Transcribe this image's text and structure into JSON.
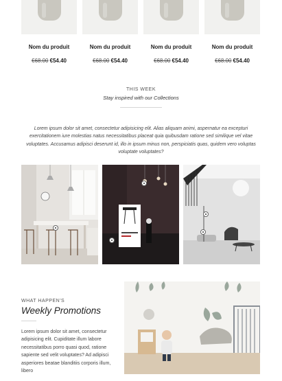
{
  "products": [
    {
      "name": "Nom du produit",
      "old_price": "€68.00",
      "new_price": "€54.40"
    },
    {
      "name": "Nom du produit",
      "old_price": "€68.00",
      "new_price": "€54.40"
    },
    {
      "name": "Nom du produit",
      "old_price": "€68.00",
      "new_price": "€54.40"
    },
    {
      "name": "Nom du produit",
      "old_price": "€68.00",
      "new_price": "€54.40"
    }
  ],
  "this_week": {
    "eyebrow": "THIS WEEK",
    "subtitle": "Stay inspired with our Collections",
    "text": "Lorem ipsum dolor sit amet, consectetur adipisicing elit. Alias aliquam animi, aspernatur ea excepturi exercitationem iure molestias natus necessitatibus placeat quia quibusdam ratione sed similique vel vitae voluptates. Accusamus adipisci deserunt id, illo in ipsum minus non, perspiciatis quas, quidem vero voluptas voluptate voluptates?"
  },
  "gallery": [
    {
      "name": "dining-room-photo"
    },
    {
      "name": "dark-studio-photo"
    },
    {
      "name": "living-room-photo"
    }
  ],
  "promotions": {
    "eyebrow": "WHAT HAPPEN'S",
    "title": "Weekly Promotions",
    "text": "Lorem ipsum dolor sit amet, consectetur adipisicing elit. Cupiditate illum labore necessitatibus porro quasi quod, ratione sapiente sed velit voluptates? Ad adipisci asperiores beatae blanditiis corporis illum, libero"
  },
  "colors": {
    "text": "#222222",
    "muted": "#555555",
    "rule": "#d6d6d6",
    "tile_bg": "#f1f1ef"
  }
}
